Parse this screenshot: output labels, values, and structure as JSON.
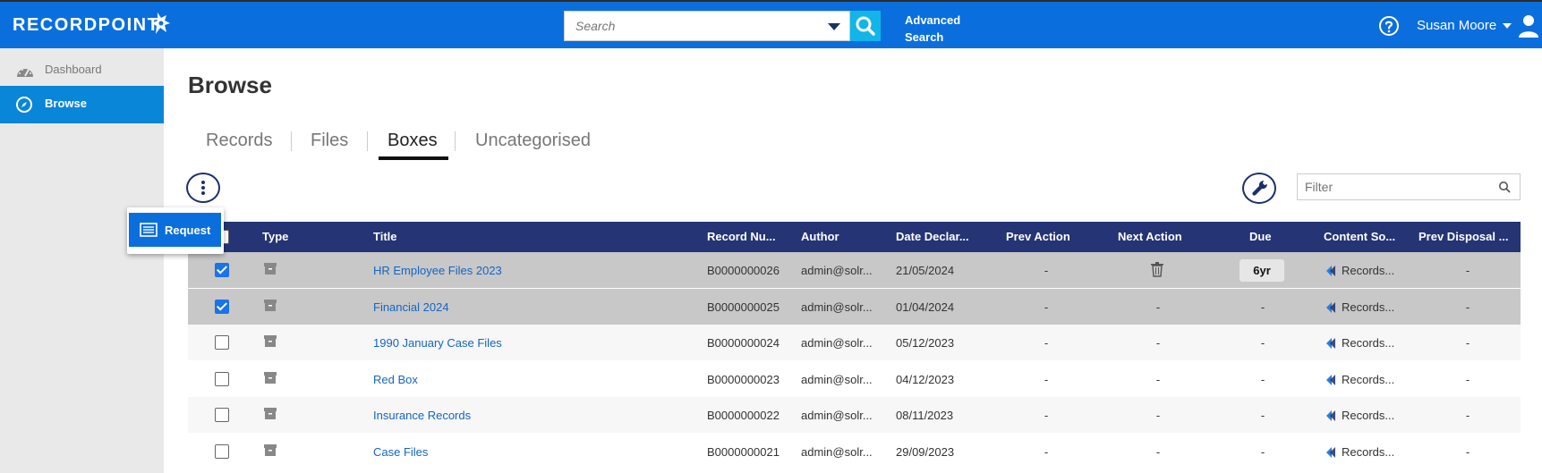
{
  "app": {
    "brand": "RECORDPOINT"
  },
  "header": {
    "search": {
      "placeholder": "Search"
    },
    "advanced_search": "Advanced\nSearch",
    "user_name": "Susan Moore"
  },
  "sidebar": {
    "items": [
      {
        "label": "Dashboard",
        "icon": "dashboard-icon"
      },
      {
        "label": "Browse",
        "icon": "compass-icon",
        "active": true
      }
    ]
  },
  "main": {
    "title": "Browse",
    "tabs": [
      {
        "label": "Records"
      },
      {
        "label": "Files"
      },
      {
        "label": "Boxes",
        "active": true
      },
      {
        "label": "Uncategorised"
      }
    ],
    "filter": {
      "placeholder": "Filter"
    },
    "popup": {
      "request_label": "Request"
    }
  },
  "table": {
    "columns": [
      "Type",
      "Title",
      "Record Nu...",
      "Author",
      "Date Declar...",
      "Prev Action",
      "Next Action",
      "Due",
      "Content So...",
      "Prev Disposal ..."
    ],
    "rows": [
      {
        "checked": true,
        "title": "HR Employee Files 2023",
        "record_number": "B0000000026",
        "author": "admin@solr...",
        "date": "21/05/2024",
        "prev_action": "-",
        "next_action": "trash-icon",
        "due": "6yr",
        "content_source": "Records...",
        "prev_disposal": "-"
      },
      {
        "checked": true,
        "title": "Financial 2024",
        "record_number": "B0000000025",
        "author": "admin@solr...",
        "date": "01/04/2024",
        "prev_action": "-",
        "next_action": "-",
        "due": "-",
        "content_source": "Records...",
        "prev_disposal": "-"
      },
      {
        "checked": false,
        "title": "1990 January Case Files",
        "record_number": "B0000000024",
        "author": "admin@solr...",
        "date": "05/12/2023",
        "prev_action": "-",
        "next_action": "-",
        "due": "-",
        "content_source": "Records...",
        "prev_disposal": "-"
      },
      {
        "checked": false,
        "title": "Red Box",
        "record_number": "B0000000023",
        "author": "admin@solr...",
        "date": "04/12/2023",
        "prev_action": "-",
        "next_action": "-",
        "due": "-",
        "content_source": "Records...",
        "prev_disposal": "-"
      },
      {
        "checked": false,
        "title": "Insurance Records",
        "record_number": "B0000000022",
        "author": "admin@solr...",
        "date": "08/11/2023",
        "prev_action": "-",
        "next_action": "-",
        "due": "-",
        "content_source": "Records...",
        "prev_disposal": "-"
      },
      {
        "checked": false,
        "title": "Case Files",
        "record_number": "B0000000021",
        "author": "admin@solr...",
        "date": "29/09/2023",
        "prev_action": "-",
        "next_action": "-",
        "due": "-",
        "content_source": "Records...",
        "prev_disposal": "-"
      }
    ]
  },
  "colors": {
    "topbar": "#0a6fdc",
    "table_header": "#253474",
    "link": "#1565c0",
    "selected_row": "#c8c8c8",
    "active_sidebar": "#0a86d8"
  }
}
